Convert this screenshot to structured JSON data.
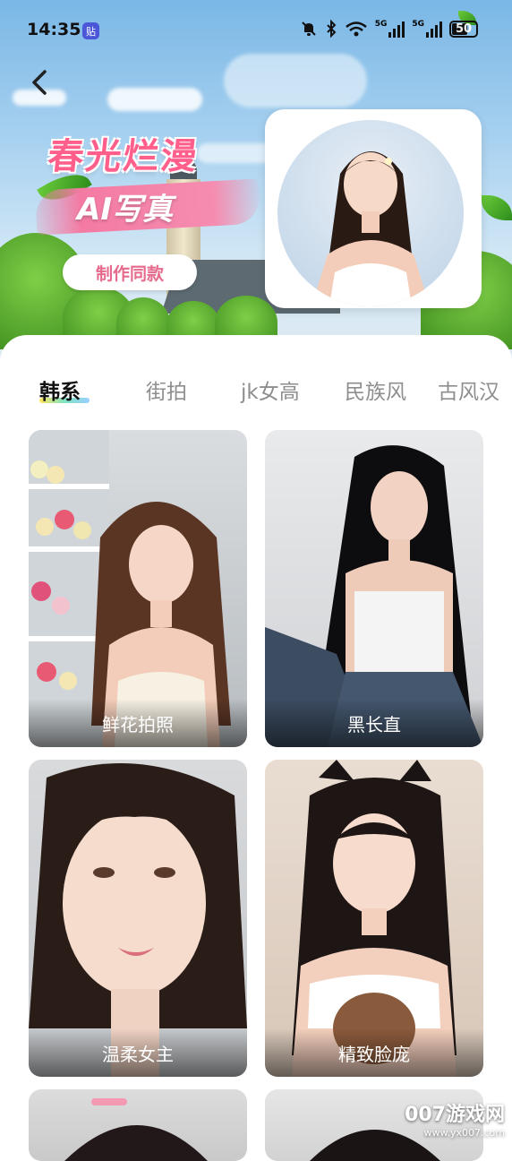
{
  "status_bar": {
    "time": "14:35",
    "sticker_label": "贴",
    "battery": "50",
    "net_label_1": "5G",
    "net_label_2": "5G"
  },
  "hero": {
    "title": "春光烂漫",
    "subtitle": "AI写真",
    "make_button": "制作同款"
  },
  "tabs": [
    {
      "label": "韩系",
      "active": true
    },
    {
      "label": "街拍",
      "active": false
    },
    {
      "label": "jk女高",
      "active": false
    },
    {
      "label": "民族风",
      "active": false
    },
    {
      "label": "古风汉",
      "active": false
    }
  ],
  "cards": [
    {
      "caption": "鲜花拍照"
    },
    {
      "caption": "黑长直"
    },
    {
      "caption": "温柔女主"
    },
    {
      "caption": "精致脸庞"
    }
  ],
  "watermark": {
    "brand": "007游戏网",
    "url": "www.yx007.com"
  },
  "colors": {
    "accent_pink": "#ff5f8a",
    "button_text_pink": "#e66a8b",
    "tab_active": "#111111",
    "tab_inactive": "#8e8e8e"
  }
}
